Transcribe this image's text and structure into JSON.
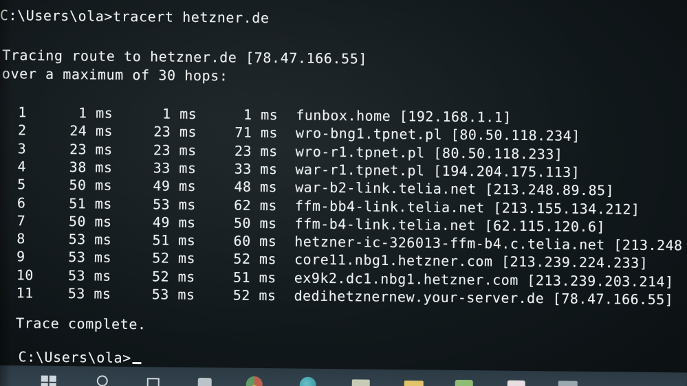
{
  "console": {
    "command_line": "C:\\Users\\ola>tracert hetzner.de",
    "header_line1": "Tracing route to hetzner.de [78.47.166.55]",
    "header_line2": "over a maximum of 30 hops:",
    "hops": [
      {
        "n": "1",
        "t1": "1 ms",
        "t2": "1 ms",
        "t3": "1 ms",
        "host": "funbox.home [192.168.1.1]"
      },
      {
        "n": "2",
        "t1": "24 ms",
        "t2": "23 ms",
        "t3": "71 ms",
        "host": "wro-bng1.tpnet.pl [80.50.118.234]"
      },
      {
        "n": "3",
        "t1": "23 ms",
        "t2": "23 ms",
        "t3": "23 ms",
        "host": "wro-r1.tpnet.pl [80.50.118.233]"
      },
      {
        "n": "4",
        "t1": "38 ms",
        "t2": "33 ms",
        "t3": "33 ms",
        "host": "war-r1.tpnet.pl [194.204.175.113]"
      },
      {
        "n": "5",
        "t1": "50 ms",
        "t2": "49 ms",
        "t3": "48 ms",
        "host": "war-b2-link.telia.net [213.248.89.85]"
      },
      {
        "n": "6",
        "t1": "51 ms",
        "t2": "53 ms",
        "t3": "62 ms",
        "host": "ffm-bb4-link.telia.net [213.155.134.212]"
      },
      {
        "n": "7",
        "t1": "50 ms",
        "t2": "49 ms",
        "t3": "50 ms",
        "host": "ffm-b4-link.telia.net [62.115.120.6]"
      },
      {
        "n": "8",
        "t1": "53 ms",
        "t2": "51 ms",
        "t3": "60 ms",
        "host": "hetzner-ic-326013-ffm-b4.c.telia.net [213.248"
      },
      {
        "n": "9",
        "t1": "53 ms",
        "t2": "52 ms",
        "t3": "52 ms",
        "host": "core11.nbg1.hetzner.com [213.239.224.233]"
      },
      {
        "n": "10",
        "t1": "53 ms",
        "t2": "52 ms",
        "t3": "51 ms",
        "host": "ex9k2.dc1.nbg1.hetzner.com [213.239.203.214]"
      },
      {
        "n": "11",
        "t1": "53 ms",
        "t2": "53 ms",
        "t3": "52 ms",
        "host": "dedihetznernew.your-server.de [78.47.166.55]"
      }
    ],
    "trace_complete": "Trace complete.",
    "prompt": "C:\\Users\\ola>"
  },
  "taskbar": {
    "icons": [
      "windows-start-icon",
      "search-icon",
      "task-view-icon",
      "store-icon",
      "chrome-icon",
      "edge-icon",
      "app-icon",
      "folder-icon",
      "app-icon",
      "app-icon",
      "app-icon"
    ]
  }
}
